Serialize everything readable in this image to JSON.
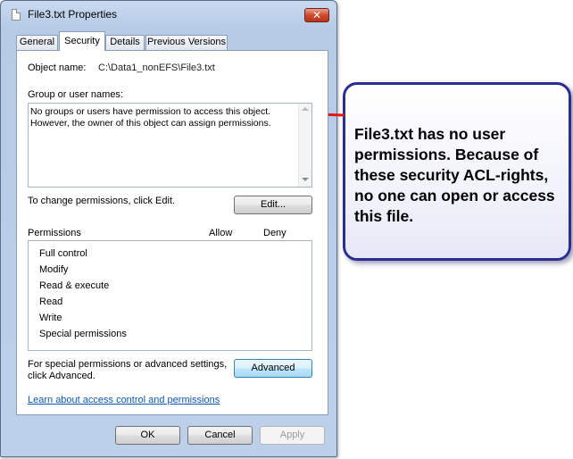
{
  "window": {
    "title": "File3.txt Properties",
    "close_label": "✕"
  },
  "tabs": [
    {
      "label": "General",
      "active": false
    },
    {
      "label": "Security",
      "active": true
    },
    {
      "label": "Details",
      "active": false
    },
    {
      "label": "Previous Versions",
      "active": false
    }
  ],
  "security": {
    "object_name_label": "Object name:",
    "object_name_value": "C:\\Data1_nonEFS\\File3.txt",
    "group_names_label": "Group or user names:",
    "group_names_message_line1": "No groups or users have permission to access this object.",
    "group_names_message_line2": "However, the owner of this object can assign permissions.",
    "change_permissions_text": "To change permissions, click Edit.",
    "edit_button": "Edit...",
    "permissions_header": "Permissions",
    "allow_header": "Allow",
    "deny_header": "Deny",
    "permissions": [
      "Full control",
      "Modify",
      "Read & execute",
      "Read",
      "Write",
      "Special permissions"
    ],
    "special_text_line1": "For special permissions or advanced settings,",
    "special_text_line2": "click Advanced.",
    "advanced_button": "Advanced",
    "learn_link": "Learn about access control and permissions"
  },
  "buttons": {
    "ok": "OK",
    "cancel": "Cancel",
    "apply": "Apply"
  },
  "callout": {
    "text": "File3.txt has no user permissions. Because of these security ACL-rights, no one can open or access this file.",
    "border_color": "#2a2f8f",
    "arrow_color": "#e0161b"
  }
}
